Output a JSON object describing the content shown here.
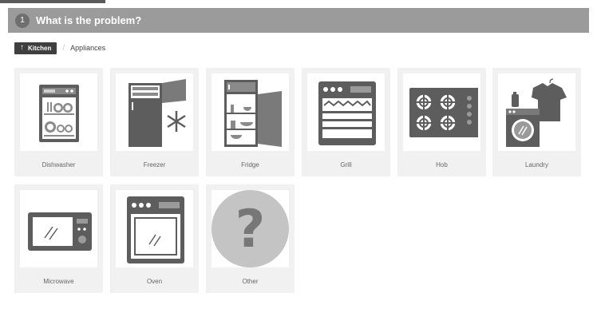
{
  "step": {
    "number": "1",
    "title": "What is the problem?"
  },
  "breadcrumb": {
    "home": "Kitchen",
    "separator": "/",
    "current": "Appliances"
  },
  "appliances": [
    {
      "label": "Dishwasher",
      "icon": "dishwasher-icon"
    },
    {
      "label": "Freezer",
      "icon": "freezer-icon"
    },
    {
      "label": "Fridge",
      "icon": "fridge-icon"
    },
    {
      "label": "Grill",
      "icon": "grill-icon"
    },
    {
      "label": "Hob",
      "icon": "hob-icon"
    },
    {
      "label": "Laundry",
      "icon": "laundry-icon"
    },
    {
      "label": "Microwave",
      "icon": "microwave-icon"
    },
    {
      "label": "Oven",
      "icon": "oven-icon"
    },
    {
      "label": "Other",
      "icon": "question-icon"
    }
  ]
}
